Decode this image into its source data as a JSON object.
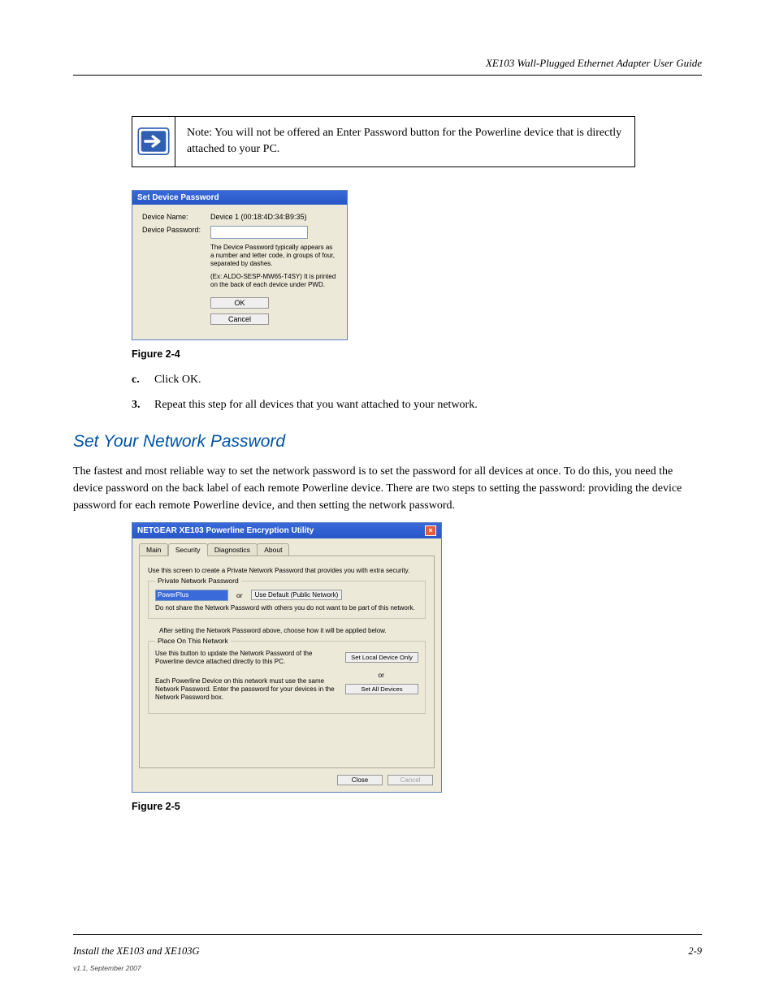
{
  "header": {
    "product": "XE103 Wall-Plugged Ethernet Adapter User Guide"
  },
  "noteBox": {
    "text": "Note: You will not be offered an Enter Password button for the Powerline device that is directly attached to your PC."
  },
  "dialogSmall": {
    "title": "Set Device Password",
    "labelDeviceName": "Device Name:",
    "valueDeviceName": "Device 1  (00:18:4D:34:B9:35)",
    "labelDevicePassword": "Device Password:",
    "help1": "The Device Password typically appears as a number and letter code, in groups of four, separated by dashes.",
    "help2": "(Ex: ALDO-SESP-MW65-T4SY) It is printed on the back of each device under PWD.",
    "btnOK": "OK",
    "btnCancel": "Cancel"
  },
  "fig4": {
    "caption": "Figure 2-4"
  },
  "steps": {
    "c": {
      "marker": "c.",
      "text": "Click OK."
    },
    "step3": {
      "marker": "3.",
      "text": "Repeat this step for all devices that you want attached to your network."
    }
  },
  "section": {
    "heading": "Set Your Network Password",
    "para": "The fastest and most reliable way to set the network password is to set the password for all devices at once. To do this, you need the device password on the back label of each remote Powerline device. There are two steps to setting the password: providing the device password for each remote Powerline device, and then setting the network password."
  },
  "dialogLarge": {
    "title": "NETGEAR XE103 Powerline Encryption Utility",
    "tabs": {
      "main": "Main",
      "security": "Security",
      "diagnostics": "Diagnostics",
      "about": "About"
    },
    "introLine": "Use this screen to create a Private Network Password that provides you with extra security.",
    "pnpLegend": "Private Network Password",
    "pnpValue": "PowerPlus",
    "or": "or",
    "useDefaultBtn": "Use Default (Public Network)",
    "shareWarn": "Do not share the Network Password with others you do not want to be part of this network.",
    "afterSetLine": "After setting the Network Password above, choose how it will be applied below.",
    "ponLegend": "Place On This Network",
    "ponText1": "Use this button to update the Network Password of the Powerline device attached directly to this PC.",
    "btnLocalOnly": "Set Local Device Only",
    "ponText2": "Each Powerline Device on this network must use the same Network Password. Enter the password for your devices in the Network Password box.",
    "btnAllDevices": "Set All Devices",
    "btnClose": "Close",
    "btnCancel": "Cancel"
  },
  "fig5": {
    "caption": "Figure 2-5"
  },
  "footer": {
    "left": "Install the XE103 and XE103G",
    "right": "2-9",
    "version": "v1.1, September 2007"
  }
}
